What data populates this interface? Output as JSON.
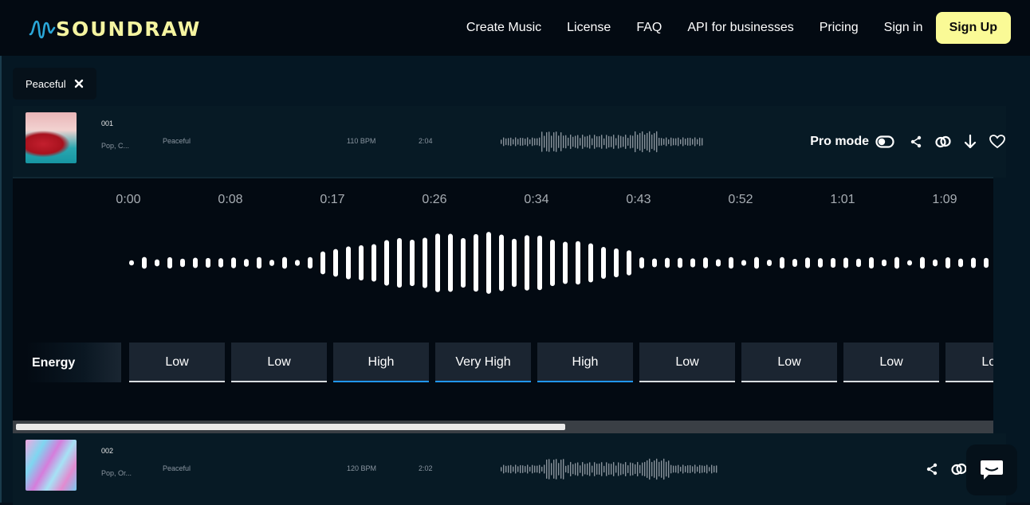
{
  "nav": {
    "brand": "SOUNDRAW",
    "links": [
      "Create Music",
      "License",
      "FAQ",
      "API for businesses",
      "Pricing",
      "Sign in"
    ],
    "signup_label": "Sign Up",
    "brand_color": "#f5f4a0",
    "signup_color": "#fafa96"
  },
  "filter": {
    "chip_label": "Peaceful"
  },
  "tracks": [
    {
      "number": "001",
      "genre": "Pop, C...",
      "mood": "Peaceful",
      "bpm": "110 BPM",
      "length": "2:04",
      "pro_mode_label": "Pro mode"
    },
    {
      "number": "002",
      "genre": "Pop, Or...",
      "mood": "Peaceful",
      "bpm": "120 BPM",
      "length": "2:02"
    }
  ],
  "timeline": {
    "ticks": [
      "0:00",
      "0:08",
      "0:17",
      "0:26",
      "0:34",
      "0:43",
      "0:52",
      "1:01",
      "1:09"
    ]
  },
  "energy": {
    "label": "Energy",
    "segments": [
      {
        "text": "Low",
        "highlight": false
      },
      {
        "text": "Low",
        "highlight": false
      },
      {
        "text": "High",
        "highlight": true
      },
      {
        "text": "Very High",
        "highlight": true
      },
      {
        "text": "High",
        "highlight": true
      },
      {
        "text": "Low",
        "highlight": false
      },
      {
        "text": "Low",
        "highlight": false
      },
      {
        "text": "Low",
        "highlight": false
      },
      {
        "text": "Low",
        "highlight": false
      }
    ],
    "highlight_color": "#2196f3"
  },
  "scrollbar": {
    "position": 0.56
  },
  "icons": {
    "chip_close": "close-icon",
    "share": "share-icon",
    "link": "link-icon",
    "download": "download-icon",
    "favorite": "heart-icon",
    "toggle": "toggle-icon",
    "chat": "chat-icon"
  }
}
